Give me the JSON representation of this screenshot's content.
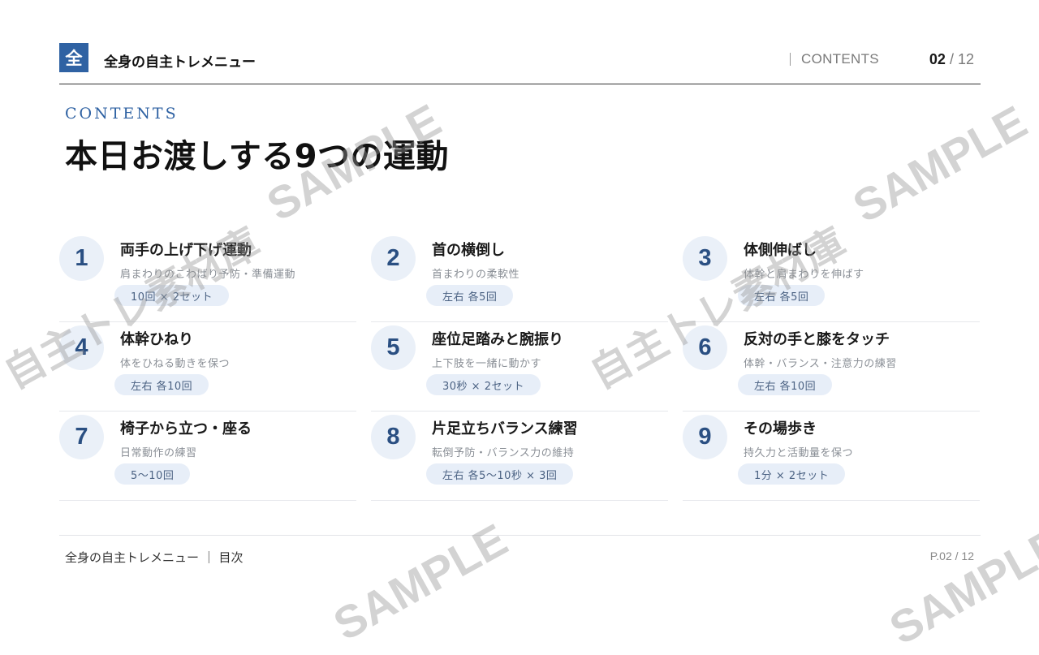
{
  "header": {
    "logo_char": "全",
    "app_title": "全身の自主トレメニュー",
    "section_label": "CONTENTS",
    "page_current": "02",
    "page_sep": " / ",
    "page_total": "12"
  },
  "main": {
    "eyebrow": "CONTENTS",
    "title": "本日お渡しする9つの運動"
  },
  "exercises": [
    {
      "num": "1",
      "title": "両手の上げ下げ運動",
      "desc": "肩まわりのこわばり予防・準備運動",
      "reps": "10回 × 2セット"
    },
    {
      "num": "2",
      "title": "首の横倒し",
      "desc": "首まわりの柔軟性",
      "reps": "左右 各5回"
    },
    {
      "num": "3",
      "title": "体側伸ばし",
      "desc": "体幹と肩まわりを伸ばす",
      "reps": "左右 各5回"
    },
    {
      "num": "4",
      "title": "体幹ひねり",
      "desc": "体をひねる動きを保つ",
      "reps": "左右 各10回"
    },
    {
      "num": "5",
      "title": "座位足踏みと腕振り",
      "desc": "上下肢を一緒に動かす",
      "reps": "30秒 × 2セット"
    },
    {
      "num": "6",
      "title": "反対の手と膝をタッチ",
      "desc": "体幹・バランス・注意力の練習",
      "reps": "左右 各10回"
    },
    {
      "num": "7",
      "title": "椅子から立つ・座る",
      "desc": "日常動作の練習",
      "reps": "5〜10回"
    },
    {
      "num": "8",
      "title": "片足立ちバランス練習",
      "desc": "転倒予防・バランス力の維持",
      "reps": "左右 各5〜10秒 × 3回"
    },
    {
      "num": "9",
      "title": "その場歩き",
      "desc": "持久力と活動量を保つ",
      "reps": "1分 × 2セット"
    }
  ],
  "footer": {
    "left": "全身の自主トレメニュー ｜ 目次",
    "right": "P.02 / 12"
  },
  "watermark": {
    "text_en": "SAMPLE",
    "text_jp": "自主トレ素材庫"
  },
  "colors": {
    "accent": "#2f62a3",
    "number_bg": "#eaf0f8",
    "pill_bg": "#e7eef8",
    "watermark": "#969696"
  }
}
